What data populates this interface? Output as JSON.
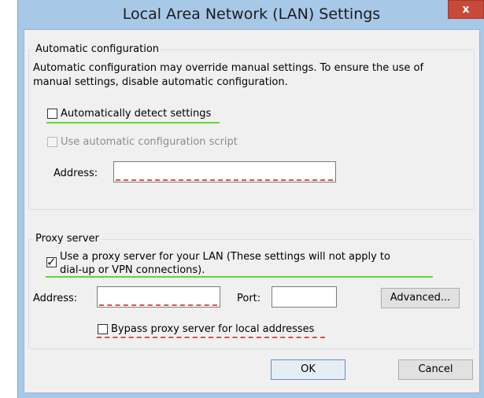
{
  "window": {
    "title": "Local Area Network (LAN) Settings",
    "close_glyph": "x"
  },
  "auto": {
    "legend": "Automatic configuration",
    "desc_line1": "Automatic configuration may override manual settings.  To ensure the use of",
    "desc_line2": "manual settings, disable automatic configuration.",
    "detect_label": "Automatically detect settings",
    "detect_checked": false,
    "script_label": "Use automatic configuration script",
    "script_checked": false,
    "script_enabled": false,
    "address_label": "Address:",
    "address_value": ""
  },
  "proxy": {
    "legend": "Proxy server",
    "use_label_line1": "Use a proxy server for your LAN (These settings will not apply to",
    "use_label_line2": "dial-up or VPN connections).",
    "use_checked": true,
    "check_glyph": "✓",
    "address_label": "Address:",
    "address_value": "",
    "port_label": "Port:",
    "port_value": "",
    "advanced_label": "Advanced...",
    "bypass_label": "Bypass proxy server for local addresses",
    "bypass_checked": false
  },
  "footer": {
    "ok_label": "OK",
    "cancel_label": "Cancel"
  },
  "colors": {
    "titlebar": "#a8c8e8",
    "close": "#c7493a",
    "highlight_line": "#5ad93a",
    "spell_underline": "#d9534f"
  }
}
